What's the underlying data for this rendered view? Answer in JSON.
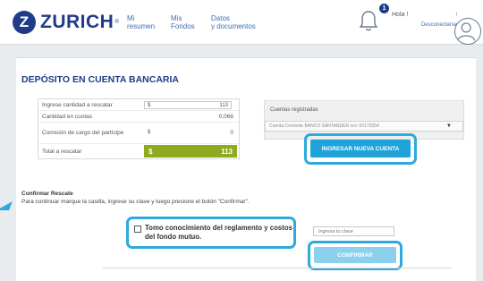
{
  "brand": {
    "name": "ZURICH",
    "registered": "®",
    "mark_letter": "Z",
    "color": "#1f3c88"
  },
  "nav": [
    {
      "line1": "Mi",
      "line2": "resumen"
    },
    {
      "line1": "Mis",
      "line2": "Fondos"
    },
    {
      "line1": "Datos",
      "line2": "y documentos"
    }
  ],
  "user": {
    "greeting": "Hola !",
    "notifications": "1",
    "logout_line1": "!",
    "logout_line2": "Desconectarse"
  },
  "page": {
    "title": "DEPÓSITO EN CUENTA BANCARIA"
  },
  "form": {
    "amount_label": "Ingrese cantidad a rescatar",
    "amount_currency": "$",
    "amount_value": "113",
    "cuotas_label": "Cantidad en cuotas",
    "cuotas_value": "0,066",
    "commission_label": "Comisión de cargo del partícipe",
    "commission_currency": "$",
    "commission_value": "0",
    "total_label": "Total a rescatar",
    "total_currency": "$",
    "total_value": "113"
  },
  "accounts": {
    "title": "Cuentas registradas",
    "selected": "Cuenta Corriente BANCO SANTANDER nro: 62173254",
    "new_account_button": "INGRESAR NUEVA CUENTA"
  },
  "confirm": {
    "title": "Confirmar Rescate",
    "instructions": "Para continuar marque la casilla, ingrese su clave y luego presione el botón \"Confirmar\".",
    "checkbox_label": "Tomo conocimiento del reglamento y costos del fondo mutuo.",
    "password_placeholder": "Ingresa tu clave",
    "confirm_button": "CONFIRMAR"
  },
  "colors": {
    "accent": "#1fa3d9",
    "highlight": "#2fa9dc",
    "total_green": "#8faa1e",
    "background": "#e9ecef"
  }
}
